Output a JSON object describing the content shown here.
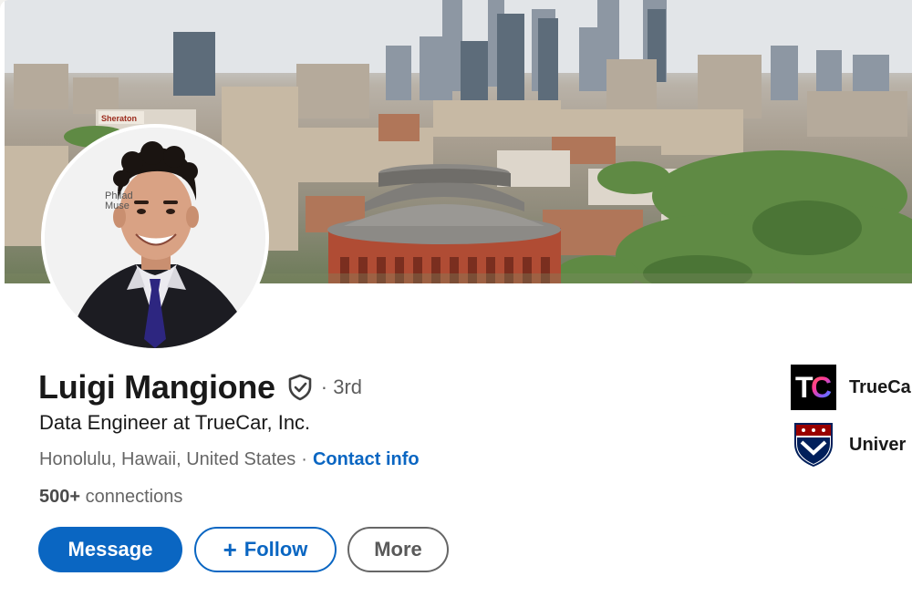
{
  "profile": {
    "name": "Luigi Mangione",
    "degree": "· 3rd",
    "headline": "Data Engineer at TrueCar, Inc.",
    "location": "Honolulu, Hawaii, United States",
    "separator": "·",
    "contact_info_label": "Contact info",
    "connections_count": "500+",
    "connections_label": "connections",
    "verified_icon": "verified-shield-icon",
    "avatar_backdrop_text": "Philad\nMuse",
    "cover_signage_text": "Sheraton"
  },
  "actions": {
    "message_label": "Message",
    "follow_label": "Follow",
    "follow_icon": "plus-icon",
    "more_label": "More"
  },
  "highlights": [
    {
      "logo": "truecar-logo",
      "logo_text": "TC",
      "label": "TrueCa"
    },
    {
      "logo": "upenn-shield-logo",
      "label": "Univer"
    }
  ],
  "colors": {
    "primary": "#0a66c2",
    "text": "#191919",
    "muted": "#666666"
  }
}
